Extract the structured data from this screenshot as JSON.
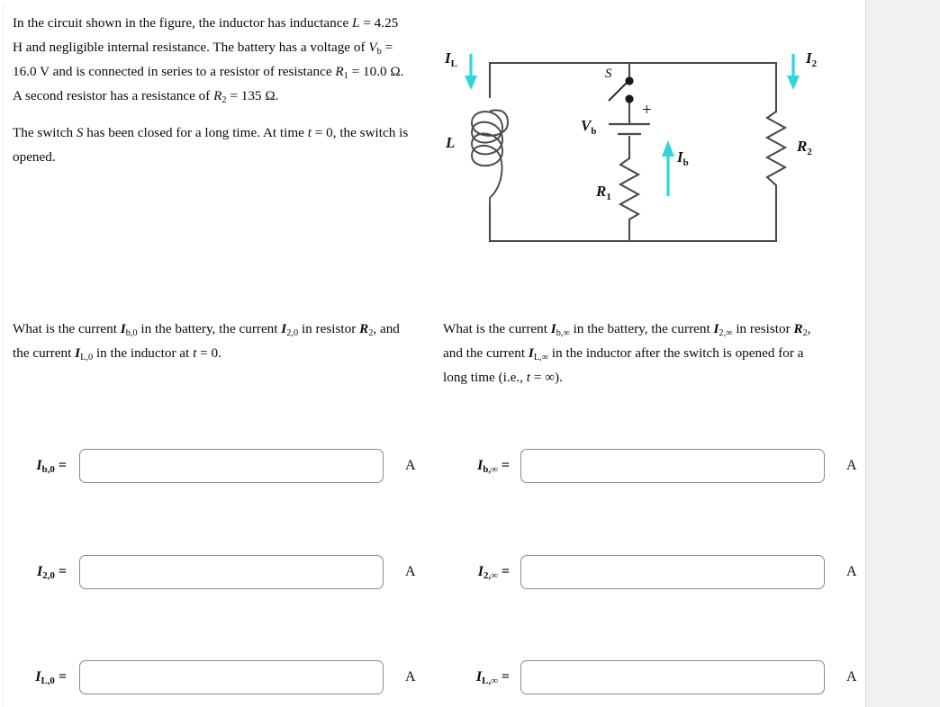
{
  "colors": {
    "wire": "#4a4a4a",
    "arrow_cyan": "#2fd5dc",
    "page_bg": "#ffffff",
    "outer_bg": "#f1f1f1",
    "input_border": "#8a8a8a",
    "text": "#0a0a0a"
  },
  "intro": {
    "line1_a": "In the circuit shown in the figure, the inductor has inductance ",
    "sym_L": "L",
    "eq1": " = ",
    "val_L": "4.25 H",
    "line1_b": " and negligible internal resistance. The battery has a voltage of ",
    "sym_Vb": "V",
    "sub_b": "b",
    "val_Vb": "16.0 V",
    "line1_c": " and is connected in series to a resistor of resistance ",
    "sym_R1": "R",
    "sub_1": "1",
    "val_R1": "10.0 Ω",
    "line1_d": ". A second resistor has a resistance of ",
    "sym_R2": "R",
    "sub_2": "2",
    "val_R2": "135 Ω",
    "line1_e": ".",
    "line2_a": "The switch ",
    "sym_S": "S",
    "line2_b": " has been closed for a long time. At time ",
    "sym_t": "t",
    "val_t": "0",
    "line2_c": ", the switch is opened."
  },
  "figure": {
    "label_IL": "I",
    "label_IL_sub": "L",
    "label_I2": "I",
    "label_I2_sub": "2",
    "label_Ib": "I",
    "label_Ib_sub": "b",
    "label_L": "L",
    "label_S": "S",
    "label_Vb": "V",
    "label_Vb_sub": "b",
    "label_plus": "+",
    "label_R1": "R",
    "label_R1_sub": "1",
    "label_R2": "R",
    "label_R2_sub": "2"
  },
  "question_left": {
    "a": "What is the current ",
    "sym_Ib0": "I",
    "sub_Ib0": "b,0",
    "b": " in the battery, the current ",
    "sym_I20": "I",
    "sub_I20": "2,0",
    "c": " in resistor ",
    "sym_R2": "R",
    "sub_R2": "2",
    "d": ", and the current ",
    "sym_IL0": "I",
    "sub_IL0": "L,0",
    "e": " in the inductor at ",
    "sym_t": "t",
    "f": " = 0."
  },
  "question_right": {
    "a": "What is the current ",
    "sym_Ibinf": "I",
    "sub_Ibinf": "b,∞",
    "b": " in the battery, the current ",
    "sym_I2inf": "I",
    "sub_I2inf": "2,∞",
    "c": " in resistor ",
    "sym_R2": "R",
    "sub_R2": "2",
    "d": ", and the current ",
    "sym_ILinf": "I",
    "sub_ILinf": "L,∞",
    "e": " in the inductor after the switch is opened for a long time (i.e., ",
    "sym_t": "t",
    "f": " = ∞)."
  },
  "answers": {
    "unit": "A",
    "left": [
      {
        "sym": "I",
        "sub": "b,0",
        "eq": "=",
        "value": "",
        "placeholder": ""
      },
      {
        "sym": "I",
        "sub": "2,0",
        "eq": "=",
        "value": "",
        "placeholder": ""
      },
      {
        "sym": "I",
        "sub": "L,0",
        "eq": "=",
        "value": "",
        "placeholder": ""
      }
    ],
    "right": [
      {
        "sym": "I",
        "sub": "b,∞",
        "eq": "=",
        "value": "",
        "placeholder": ""
      },
      {
        "sym": "I",
        "sub": "2,∞",
        "eq": "=",
        "value": "",
        "placeholder": ""
      },
      {
        "sym": "I",
        "sub": "L,∞",
        "eq": "=",
        "value": "",
        "placeholder": ""
      }
    ]
  }
}
